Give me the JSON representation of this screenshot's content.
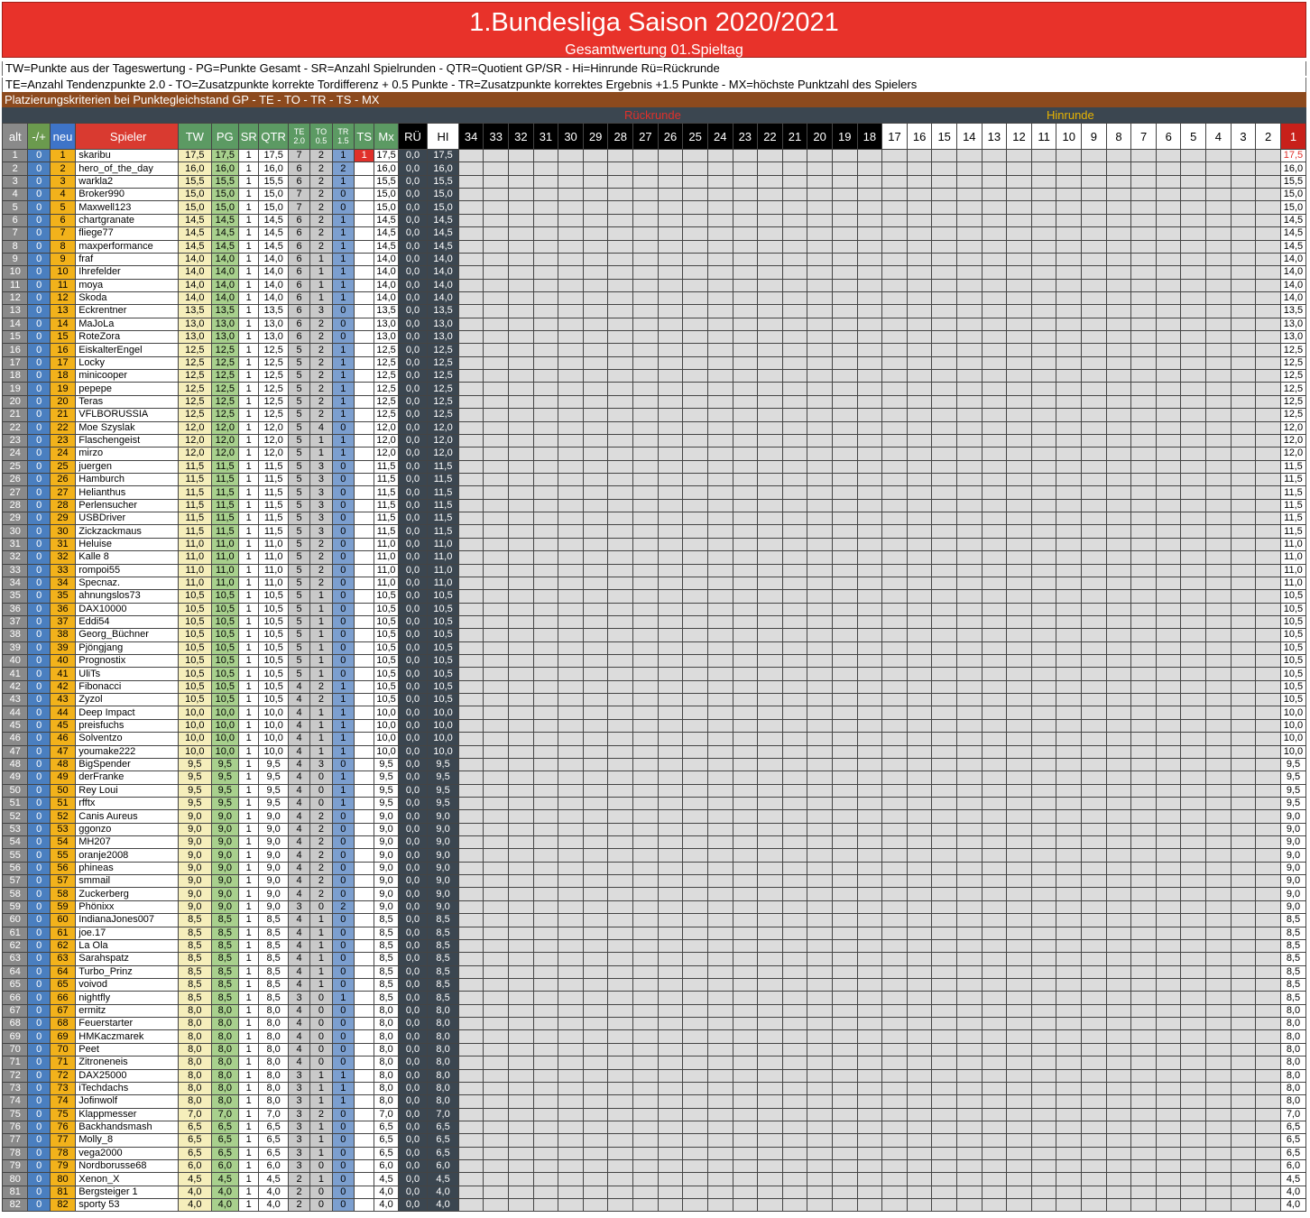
{
  "title": "1.Bundesliga Saison 2020/2021",
  "subtitle": "Gesamtwertung 01.Spieltag",
  "legend_line1": "TW=Punkte aus der Tageswertung - PG=Punkte Gesamt - SR=Anzahl Spielrunden - QTR=Quotient GP/SR - Hi=Hinrunde Rü=Rückrunde",
  "legend_line2": "TE=Anzahl Tendenzpunkte 2.0 - TO=Zusatzpunkte korrekte Tordifferenz + 0.5 Punkte - TR=Zusatzpunkte korrektes Ergebnis +1.5 Punkte - MX=höchste Punktzahl des Spielers",
  "criteria": "Platzierungskriterien bei Punktegleichstand  GP - TE - TO - TR - TS - MX",
  "round_labels": {
    "rueckrunde": "Rückrunde",
    "hinrunde": "Hinrunde"
  },
  "headers": {
    "alt": "alt",
    "pm": "-/+",
    "neu": "neu",
    "spieler": "Spieler",
    "tw": "TW",
    "pg": "PG",
    "sr": "SR",
    "qtr": "QTR",
    "te": "TE",
    "te_sub": "2.0",
    "to": "TO",
    "to_sub": "0.5",
    "tr": "TR",
    "tr_sub": "1.5",
    "ts": "TS",
    "mx": "Mx",
    "ru": "RÜ",
    "hi": "HI",
    "rueck_rounds": [
      "34",
      "33",
      "32",
      "31",
      "30",
      "29",
      "28",
      "27",
      "26",
      "25",
      "24",
      "23",
      "22",
      "21",
      "20",
      "19",
      "18"
    ],
    "hin_rounds": [
      "17",
      "16",
      "15",
      "14",
      "13",
      "12",
      "11",
      "10",
      "9",
      "8",
      "7",
      "6",
      "5",
      "4",
      "3",
      "2",
      "1"
    ]
  },
  "colors": {
    "title_red": "#e8322a",
    "criteria_brown": "#8c4a1e",
    "header_green": "#5c9a63",
    "dark_slate": "#3b4650"
  },
  "rows": [
    [
      "1",
      "0",
      "1",
      "skaribu",
      "17,5",
      "17,5",
      "1",
      "17,5",
      "7",
      "2",
      "1",
      "1",
      "17,5",
      "0,0",
      "17,5",
      "17,5"
    ],
    [
      "2",
      "0",
      "2",
      "hero_of_the_day",
      "16,0",
      "16,0",
      "1",
      "16,0",
      "6",
      "2",
      "2",
      "",
      "16,0",
      "0,0",
      "16,0",
      "16,0"
    ],
    [
      "3",
      "0",
      "3",
      "warkla2",
      "15,5",
      "15,5",
      "1",
      "15,5",
      "6",
      "2",
      "1",
      "",
      "15,5",
      "0,0",
      "15,5",
      "15,5"
    ],
    [
      "4",
      "0",
      "4",
      "Broker990",
      "15,0",
      "15,0",
      "1",
      "15,0",
      "7",
      "2",
      "0",
      "",
      "15,0",
      "0,0",
      "15,0",
      "15,0"
    ],
    [
      "5",
      "0",
      "5",
      "Maxwell123",
      "15,0",
      "15,0",
      "1",
      "15,0",
      "7",
      "2",
      "0",
      "",
      "15,0",
      "0,0",
      "15,0",
      "15,0"
    ],
    [
      "6",
      "0",
      "6",
      "chartgranate",
      "14,5",
      "14,5",
      "1",
      "14,5",
      "6",
      "2",
      "1",
      "",
      "14,5",
      "0,0",
      "14,5",
      "14,5"
    ],
    [
      "7",
      "0",
      "7",
      "fliege77",
      "14,5",
      "14,5",
      "1",
      "14,5",
      "6",
      "2",
      "1",
      "",
      "14,5",
      "0,0",
      "14,5",
      "14,5"
    ],
    [
      "8",
      "0",
      "8",
      "maxperformance",
      "14,5",
      "14,5",
      "1",
      "14,5",
      "6",
      "2",
      "1",
      "",
      "14,5",
      "0,0",
      "14,5",
      "14,5"
    ],
    [
      "9",
      "0",
      "9",
      "fraf",
      "14,0",
      "14,0",
      "1",
      "14,0",
      "6",
      "1",
      "1",
      "",
      "14,0",
      "0,0",
      "14,0",
      "14,0"
    ],
    [
      "10",
      "0",
      "10",
      "Ihrefelder",
      "14,0",
      "14,0",
      "1",
      "14,0",
      "6",
      "1",
      "1",
      "",
      "14,0",
      "0,0",
      "14,0",
      "14,0"
    ],
    [
      "11",
      "0",
      "11",
      "moya",
      "14,0",
      "14,0",
      "1",
      "14,0",
      "6",
      "1",
      "1",
      "",
      "14,0",
      "0,0",
      "14,0",
      "14,0"
    ],
    [
      "12",
      "0",
      "12",
      "Skoda",
      "14,0",
      "14,0",
      "1",
      "14,0",
      "6",
      "1",
      "1",
      "",
      "14,0",
      "0,0",
      "14,0",
      "14,0"
    ],
    [
      "13",
      "0",
      "13",
      "Eckrentner",
      "13,5",
      "13,5",
      "1",
      "13,5",
      "6",
      "3",
      "0",
      "",
      "13,5",
      "0,0",
      "13,5",
      "13,5"
    ],
    [
      "14",
      "0",
      "14",
      "MaJoLa",
      "13,0",
      "13,0",
      "1",
      "13,0",
      "6",
      "2",
      "0",
      "",
      "13,0",
      "0,0",
      "13,0",
      "13,0"
    ],
    [
      "15",
      "0",
      "15",
      "RoteZora",
      "13,0",
      "13,0",
      "1",
      "13,0",
      "6",
      "2",
      "0",
      "",
      "13,0",
      "0,0",
      "13,0",
      "13,0"
    ],
    [
      "16",
      "0",
      "16",
      "EiskalterEngel",
      "12,5",
      "12,5",
      "1",
      "12,5",
      "5",
      "2",
      "1",
      "",
      "12,5",
      "0,0",
      "12,5",
      "12,5"
    ],
    [
      "17",
      "0",
      "17",
      "Locky",
      "12,5",
      "12,5",
      "1",
      "12,5",
      "5",
      "2",
      "1",
      "",
      "12,5",
      "0,0",
      "12,5",
      "12,5"
    ],
    [
      "18",
      "0",
      "18",
      "minicooper",
      "12,5",
      "12,5",
      "1",
      "12,5",
      "5",
      "2",
      "1",
      "",
      "12,5",
      "0,0",
      "12,5",
      "12,5"
    ],
    [
      "19",
      "0",
      "19",
      "pepepe",
      "12,5",
      "12,5",
      "1",
      "12,5",
      "5",
      "2",
      "1",
      "",
      "12,5",
      "0,0",
      "12,5",
      "12,5"
    ],
    [
      "20",
      "0",
      "20",
      "Teras",
      "12,5",
      "12,5",
      "1",
      "12,5",
      "5",
      "2",
      "1",
      "",
      "12,5",
      "0,0",
      "12,5",
      "12,5"
    ],
    [
      "21",
      "0",
      "21",
      "VFLBORUSSIA",
      "12,5",
      "12,5",
      "1",
      "12,5",
      "5",
      "2",
      "1",
      "",
      "12,5",
      "0,0",
      "12,5",
      "12,5"
    ],
    [
      "22",
      "0",
      "22",
      "Moe Szyslak",
      "12,0",
      "12,0",
      "1",
      "12,0",
      "5",
      "4",
      "0",
      "",
      "12,0",
      "0,0",
      "12,0",
      "12,0"
    ],
    [
      "23",
      "0",
      "23",
      "Flaschengeist",
      "12,0",
      "12,0",
      "1",
      "12,0",
      "5",
      "1",
      "1",
      "",
      "12,0",
      "0,0",
      "12,0",
      "12,0"
    ],
    [
      "24",
      "0",
      "24",
      "mirzo",
      "12,0",
      "12,0",
      "1",
      "12,0",
      "5",
      "1",
      "1",
      "",
      "12,0",
      "0,0",
      "12,0",
      "12,0"
    ],
    [
      "25",
      "0",
      "25",
      "juergen",
      "11,5",
      "11,5",
      "1",
      "11,5",
      "5",
      "3",
      "0",
      "",
      "11,5",
      "0,0",
      "11,5",
      "11,5"
    ],
    [
      "26",
      "0",
      "26",
      "Hamburch",
      "11,5",
      "11,5",
      "1",
      "11,5",
      "5",
      "3",
      "0",
      "",
      "11,5",
      "0,0",
      "11,5",
      "11,5"
    ],
    [
      "27",
      "0",
      "27",
      "Helianthus",
      "11,5",
      "11,5",
      "1",
      "11,5",
      "5",
      "3",
      "0",
      "",
      "11,5",
      "0,0",
      "11,5",
      "11,5"
    ],
    [
      "28",
      "0",
      "28",
      "Perlensucher",
      "11,5",
      "11,5",
      "1",
      "11,5",
      "5",
      "3",
      "0",
      "",
      "11,5",
      "0,0",
      "11,5",
      "11,5"
    ],
    [
      "29",
      "0",
      "29",
      "USBDriver",
      "11,5",
      "11,5",
      "1",
      "11,5",
      "5",
      "3",
      "0",
      "",
      "11,5",
      "0,0",
      "11,5",
      "11,5"
    ],
    [
      "30",
      "0",
      "30",
      "Zickzackmaus",
      "11,5",
      "11,5",
      "1",
      "11,5",
      "5",
      "3",
      "0",
      "",
      "11,5",
      "0,0",
      "11,5",
      "11,5"
    ],
    [
      "31",
      "0",
      "31",
      "Heluise",
      "11,0",
      "11,0",
      "1",
      "11,0",
      "5",
      "2",
      "0",
      "",
      "11,0",
      "0,0",
      "11,0",
      "11,0"
    ],
    [
      "32",
      "0",
      "32",
      "Kalle 8",
      "11,0",
      "11,0",
      "1",
      "11,0",
      "5",
      "2",
      "0",
      "",
      "11,0",
      "0,0",
      "11,0",
      "11,0"
    ],
    [
      "33",
      "0",
      "33",
      "rompoi55",
      "11,0",
      "11,0",
      "1",
      "11,0",
      "5",
      "2",
      "0",
      "",
      "11,0",
      "0,0",
      "11,0",
      "11,0"
    ],
    [
      "34",
      "0",
      "34",
      "Specnaz.",
      "11,0",
      "11,0",
      "1",
      "11,0",
      "5",
      "2",
      "0",
      "",
      "11,0",
      "0,0",
      "11,0",
      "11,0"
    ],
    [
      "35",
      "0",
      "35",
      "ahnungslos73",
      "10,5",
      "10,5",
      "1",
      "10,5",
      "5",
      "1",
      "0",
      "",
      "10,5",
      "0,0",
      "10,5",
      "10,5"
    ],
    [
      "36",
      "0",
      "36",
      "DAX10000",
      "10,5",
      "10,5",
      "1",
      "10,5",
      "5",
      "1",
      "0",
      "",
      "10,5",
      "0,0",
      "10,5",
      "10,5"
    ],
    [
      "37",
      "0",
      "37",
      "Eddi54",
      "10,5",
      "10,5",
      "1",
      "10,5",
      "5",
      "1",
      "0",
      "",
      "10,5",
      "0,0",
      "10,5",
      "10,5"
    ],
    [
      "38",
      "0",
      "38",
      "Georg_Büchner",
      "10,5",
      "10,5",
      "1",
      "10,5",
      "5",
      "1",
      "0",
      "",
      "10,5",
      "0,0",
      "10,5",
      "10,5"
    ],
    [
      "39",
      "0",
      "39",
      "Pjöngjang",
      "10,5",
      "10,5",
      "1",
      "10,5",
      "5",
      "1",
      "0",
      "",
      "10,5",
      "0,0",
      "10,5",
      "10,5"
    ],
    [
      "40",
      "0",
      "40",
      "Prognostix",
      "10,5",
      "10,5",
      "1",
      "10,5",
      "5",
      "1",
      "0",
      "",
      "10,5",
      "0,0",
      "10,5",
      "10,5"
    ],
    [
      "41",
      "0",
      "41",
      "UliTs",
      "10,5",
      "10,5",
      "1",
      "10,5",
      "5",
      "1",
      "0",
      "",
      "10,5",
      "0,0",
      "10,5",
      "10,5"
    ],
    [
      "42",
      "0",
      "42",
      "Fibonacci",
      "10,5",
      "10,5",
      "1",
      "10,5",
      "4",
      "2",
      "1",
      "",
      "10,5",
      "0,0",
      "10,5",
      "10,5"
    ],
    [
      "43",
      "0",
      "43",
      "Zyzol",
      "10,5",
      "10,5",
      "1",
      "10,5",
      "4",
      "2",
      "1",
      "",
      "10,5",
      "0,0",
      "10,5",
      "10,5"
    ],
    [
      "44",
      "0",
      "44",
      "Deep Impact",
      "10,0",
      "10,0",
      "1",
      "10,0",
      "4",
      "1",
      "1",
      "",
      "10,0",
      "0,0",
      "10,0",
      "10,0"
    ],
    [
      "45",
      "0",
      "45",
      "preisfuchs",
      "10,0",
      "10,0",
      "1",
      "10,0",
      "4",
      "1",
      "1",
      "",
      "10,0",
      "0,0",
      "10,0",
      "10,0"
    ],
    [
      "46",
      "0",
      "46",
      "Solventzo",
      "10,0",
      "10,0",
      "1",
      "10,0",
      "4",
      "1",
      "1",
      "",
      "10,0",
      "0,0",
      "10,0",
      "10,0"
    ],
    [
      "47",
      "0",
      "47",
      "youmake222",
      "10,0",
      "10,0",
      "1",
      "10,0",
      "4",
      "1",
      "1",
      "",
      "10,0",
      "0,0",
      "10,0",
      "10,0"
    ],
    [
      "48",
      "0",
      "48",
      "BigSpender",
      "9,5",
      "9,5",
      "1",
      "9,5",
      "4",
      "3",
      "0",
      "",
      "9,5",
      "0,0",
      "9,5",
      "9,5"
    ],
    [
      "49",
      "0",
      "49",
      "derFranke",
      "9,5",
      "9,5",
      "1",
      "9,5",
      "4",
      "0",
      "1",
      "",
      "9,5",
      "0,0",
      "9,5",
      "9,5"
    ],
    [
      "50",
      "0",
      "50",
      "Rey Loui",
      "9,5",
      "9,5",
      "1",
      "9,5",
      "4",
      "0",
      "1",
      "",
      "9,5",
      "0,0",
      "9,5",
      "9,5"
    ],
    [
      "51",
      "0",
      "51",
      "rfftx",
      "9,5",
      "9,5",
      "1",
      "9,5",
      "4",
      "0",
      "1",
      "",
      "9,5",
      "0,0",
      "9,5",
      "9,5"
    ],
    [
      "52",
      "0",
      "52",
      "Canis Aureus",
      "9,0",
      "9,0",
      "1",
      "9,0",
      "4",
      "2",
      "0",
      "",
      "9,0",
      "0,0",
      "9,0",
      "9,0"
    ],
    [
      "53",
      "0",
      "53",
      "ggonzo",
      "9,0",
      "9,0",
      "1",
      "9,0",
      "4",
      "2",
      "0",
      "",
      "9,0",
      "0,0",
      "9,0",
      "9,0"
    ],
    [
      "54",
      "0",
      "54",
      "MH207",
      "9,0",
      "9,0",
      "1",
      "9,0",
      "4",
      "2",
      "0",
      "",
      "9,0",
      "0,0",
      "9,0",
      "9,0"
    ],
    [
      "55",
      "0",
      "55",
      "oranje2008",
      "9,0",
      "9,0",
      "1",
      "9,0",
      "4",
      "2",
      "0",
      "",
      "9,0",
      "0,0",
      "9,0",
      "9,0"
    ],
    [
      "56",
      "0",
      "56",
      "phineas",
      "9,0",
      "9,0",
      "1",
      "9,0",
      "4",
      "2",
      "0",
      "",
      "9,0",
      "0,0",
      "9,0",
      "9,0"
    ],
    [
      "57",
      "0",
      "57",
      "smmail",
      "9,0",
      "9,0",
      "1",
      "9,0",
      "4",
      "2",
      "0",
      "",
      "9,0",
      "0,0",
      "9,0",
      "9,0"
    ],
    [
      "58",
      "0",
      "58",
      "Zuckerberg",
      "9,0",
      "9,0",
      "1",
      "9,0",
      "4",
      "2",
      "0",
      "",
      "9,0",
      "0,0",
      "9,0",
      "9,0"
    ],
    [
      "59",
      "0",
      "59",
      "Phönixx",
      "9,0",
      "9,0",
      "1",
      "9,0",
      "3",
      "0",
      "2",
      "",
      "9,0",
      "0,0",
      "9,0",
      "9,0"
    ],
    [
      "60",
      "0",
      "60",
      "IndianaJones007",
      "8,5",
      "8,5",
      "1",
      "8,5",
      "4",
      "1",
      "0",
      "",
      "8,5",
      "0,0",
      "8,5",
      "8,5"
    ],
    [
      "61",
      "0",
      "61",
      "joe.17",
      "8,5",
      "8,5",
      "1",
      "8,5",
      "4",
      "1",
      "0",
      "",
      "8,5",
      "0,0",
      "8,5",
      "8,5"
    ],
    [
      "62",
      "0",
      "62",
      "La Ola",
      "8,5",
      "8,5",
      "1",
      "8,5",
      "4",
      "1",
      "0",
      "",
      "8,5",
      "0,0",
      "8,5",
      "8,5"
    ],
    [
      "63",
      "0",
      "63",
      "Sarahspatz",
      "8,5",
      "8,5",
      "1",
      "8,5",
      "4",
      "1",
      "0",
      "",
      "8,5",
      "0,0",
      "8,5",
      "8,5"
    ],
    [
      "64",
      "0",
      "64",
      "Turbo_Prinz",
      "8,5",
      "8,5",
      "1",
      "8,5",
      "4",
      "1",
      "0",
      "",
      "8,5",
      "0,0",
      "8,5",
      "8,5"
    ],
    [
      "65",
      "0",
      "65",
      "voivod",
      "8,5",
      "8,5",
      "1",
      "8,5",
      "4",
      "1",
      "0",
      "",
      "8,5",
      "0,0",
      "8,5",
      "8,5"
    ],
    [
      "66",
      "0",
      "66",
      "nightfly",
      "8,5",
      "8,5",
      "1",
      "8,5",
      "3",
      "0",
      "1",
      "",
      "8,5",
      "0,0",
      "8,5",
      "8,5"
    ],
    [
      "67",
      "0",
      "67",
      "ermitz",
      "8,0",
      "8,0",
      "1",
      "8,0",
      "4",
      "0",
      "0",
      "",
      "8,0",
      "0,0",
      "8,0",
      "8,0"
    ],
    [
      "68",
      "0",
      "68",
      "Feuerstarter",
      "8,0",
      "8,0",
      "1",
      "8,0",
      "4",
      "0",
      "0",
      "",
      "8,0",
      "0,0",
      "8,0",
      "8,0"
    ],
    [
      "69",
      "0",
      "69",
      "HMKaczmarek",
      "8,0",
      "8,0",
      "1",
      "8,0",
      "4",
      "0",
      "0",
      "",
      "8,0",
      "0,0",
      "8,0",
      "8,0"
    ],
    [
      "70",
      "0",
      "70",
      "Peet",
      "8,0",
      "8,0",
      "1",
      "8,0",
      "4",
      "0",
      "0",
      "",
      "8,0",
      "0,0",
      "8,0",
      "8,0"
    ],
    [
      "71",
      "0",
      "71",
      "Zitroneneis",
      "8,0",
      "8,0",
      "1",
      "8,0",
      "4",
      "0",
      "0",
      "",
      "8,0",
      "0,0",
      "8,0",
      "8,0"
    ],
    [
      "72",
      "0",
      "72",
      "DAX25000",
      "8,0",
      "8,0",
      "1",
      "8,0",
      "3",
      "1",
      "1",
      "",
      "8,0",
      "0,0",
      "8,0",
      "8,0"
    ],
    [
      "73",
      "0",
      "73",
      "iTechdachs",
      "8,0",
      "8,0",
      "1",
      "8,0",
      "3",
      "1",
      "1",
      "",
      "8,0",
      "0,0",
      "8,0",
      "8,0"
    ],
    [
      "74",
      "0",
      "74",
      "Jofinwolf",
      "8,0",
      "8,0",
      "1",
      "8,0",
      "3",
      "1",
      "1",
      "",
      "8,0",
      "0,0",
      "8,0",
      "8,0"
    ],
    [
      "75",
      "0",
      "75",
      "Klappmesser",
      "7,0",
      "7,0",
      "1",
      "7,0",
      "3",
      "2",
      "0",
      "",
      "7,0",
      "0,0",
      "7,0",
      "7,0"
    ],
    [
      "76",
      "0",
      "76",
      "Backhandsmash",
      "6,5",
      "6,5",
      "1",
      "6,5",
      "3",
      "1",
      "0",
      "",
      "6,5",
      "0,0",
      "6,5",
      "6,5"
    ],
    [
      "77",
      "0",
      "77",
      "Molly_8",
      "6,5",
      "6,5",
      "1",
      "6,5",
      "3",
      "1",
      "0",
      "",
      "6,5",
      "0,0",
      "6,5",
      "6,5"
    ],
    [
      "78",
      "0",
      "78",
      "vega2000",
      "6,5",
      "6,5",
      "1",
      "6,5",
      "3",
      "1",
      "0",
      "",
      "6,5",
      "0,0",
      "6,5",
      "6,5"
    ],
    [
      "79",
      "0",
      "79",
      "Nordborusse68",
      "6,0",
      "6,0",
      "1",
      "6,0",
      "3",
      "0",
      "0",
      "",
      "6,0",
      "0,0",
      "6,0",
      "6,0"
    ],
    [
      "80",
      "0",
      "80",
      "Xenon_X",
      "4,5",
      "4,5",
      "1",
      "4,5",
      "2",
      "1",
      "0",
      "",
      "4,5",
      "0,0",
      "4,5",
      "4,5"
    ],
    [
      "81",
      "0",
      "81",
      "Bergsteiger 1",
      "4,0",
      "4,0",
      "1",
      "4,0",
      "2",
      "0",
      "0",
      "",
      "4,0",
      "0,0",
      "4,0",
      "4,0"
    ],
    [
      "82",
      "0",
      "82",
      "sporty 53",
      "4,0",
      "4,0",
      "1",
      "4,0",
      "2",
      "0",
      "0",
      "",
      "4,0",
      "0,0",
      "4,0",
      "4,0"
    ]
  ]
}
